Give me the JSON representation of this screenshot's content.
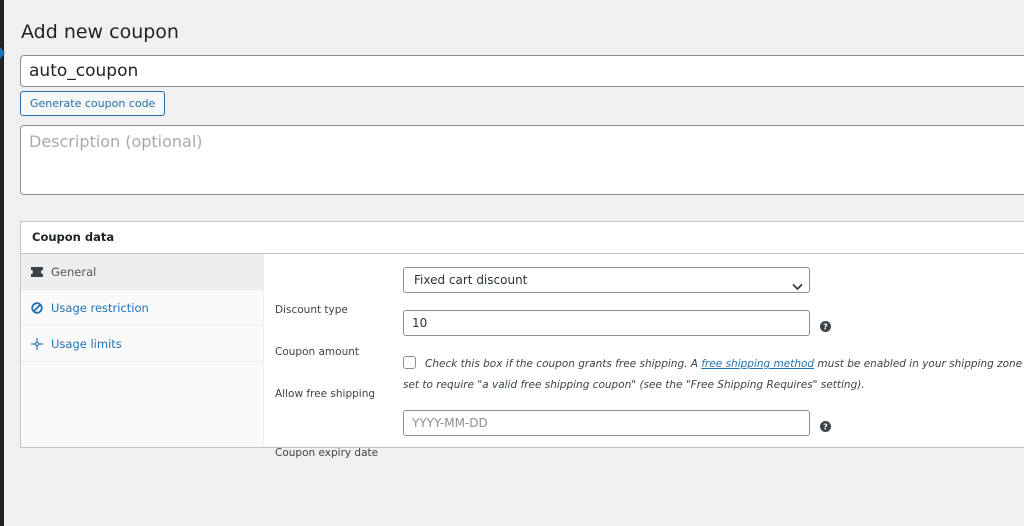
{
  "page": {
    "title": "Add new coupon"
  },
  "coupon": {
    "code_value": "auto_coupon",
    "generate_label": "Generate coupon code",
    "description_placeholder": "Description (optional)"
  },
  "panel": {
    "title": "Coupon data",
    "tabs": [
      {
        "label": "General",
        "icon": "ticket-icon",
        "active": true
      },
      {
        "label": "Usage restriction",
        "icon": "block-icon",
        "active": false
      },
      {
        "label": "Usage limits",
        "icon": "crosshair-icon",
        "active": false
      }
    ],
    "fields": {
      "discount_type": {
        "label": "Discount type",
        "value": "Fixed cart discount"
      },
      "amount": {
        "label": "Coupon amount",
        "value": "10"
      },
      "free_shipping": {
        "label": "Allow free shipping",
        "text_before": "Check this box if the coupon grants free shipping. A ",
        "link_text": "free shipping method",
        "text_after": " must be enabled in your shipping zone and be set to require \"a valid free shipping coupon\" (see the \"Free Shipping Requires\" setting).",
        "checked": false
      },
      "expiry": {
        "label": "Coupon expiry date",
        "placeholder": "YYYY-MM-DD"
      }
    }
  },
  "colors": {
    "accent": "#2271b1",
    "background": "#f0f0f1",
    "admin_bar": "#1d2327"
  }
}
